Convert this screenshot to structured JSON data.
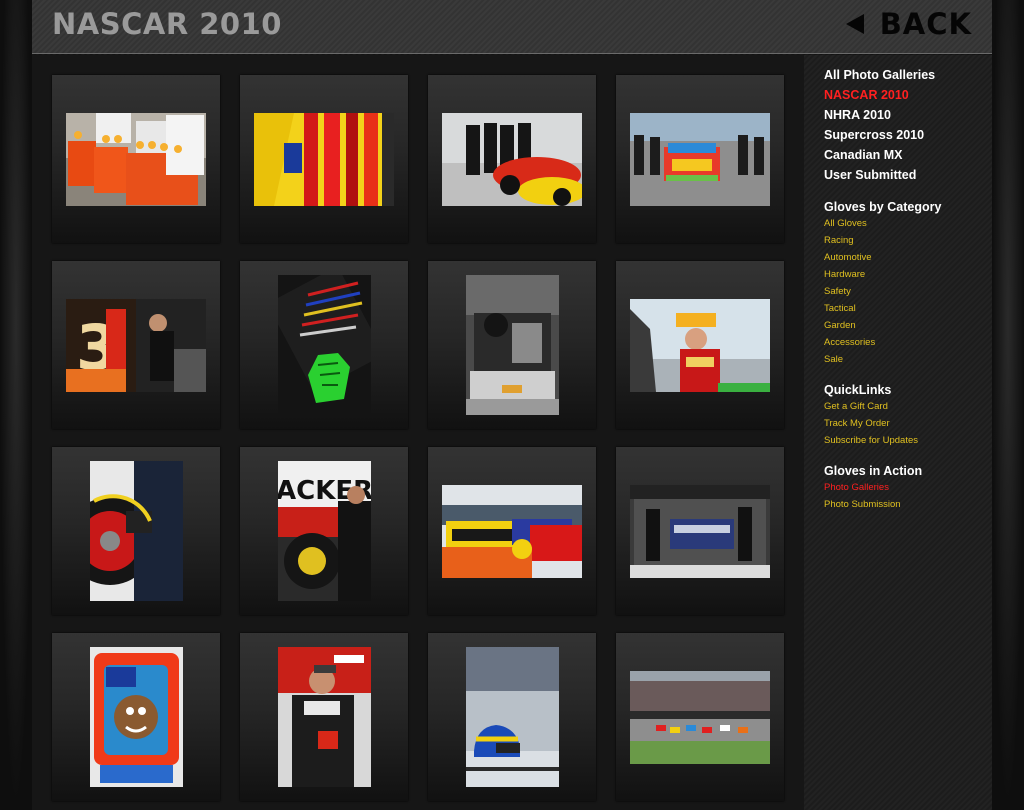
{
  "header": {
    "title": "NASCAR 2010",
    "back_label": "BACK"
  },
  "colors": {
    "title": "#9a9a9a",
    "nav_active": "#ff2020",
    "link_yellow": "#e0c020"
  },
  "sidebar": {
    "galleries": [
      {
        "label": "All Photo Galleries"
      },
      {
        "label": "NASCAR 2010",
        "active": true
      },
      {
        "label": "NHRA 2010"
      },
      {
        "label": "Supercross 2010"
      },
      {
        "label": "Canadian MX"
      },
      {
        "label": "User Submitted"
      }
    ],
    "categories": {
      "heading": "Gloves by Category",
      "items": [
        "All Gloves",
        "Racing",
        "Automotive",
        "Hardware",
        "Safety",
        "Tactical",
        "Garden",
        "Accessories",
        "Sale"
      ]
    },
    "quicklinks": {
      "heading": "QuickLinks",
      "items": [
        "Get a Gift Card",
        "Track My Order",
        "Subscribe for Updates"
      ]
    },
    "action": {
      "heading": "Gloves in Action",
      "items": [
        {
          "label": "Photo Galleries",
          "active": true
        },
        {
          "label": "Photo Submission"
        }
      ]
    }
  },
  "gallery": {
    "photos": [
      {
        "name": "coolers-photo",
        "orient": "land"
      },
      {
        "name": "car-sponsor-closeup-photo",
        "orient": "land"
      },
      {
        "name": "crew-at-cars-photo",
        "orient": "land"
      },
      {
        "name": "pit-lane-car-photo",
        "orient": "land"
      },
      {
        "name": "number-3-car-mechanic-photo",
        "orient": "land"
      },
      {
        "name": "tool-drawer-glove-photo",
        "orient": "port"
      },
      {
        "name": "engine-bay-photo",
        "orient": "port"
      },
      {
        "name": "cheesehead-fan-photo",
        "orient": "land"
      },
      {
        "name": "tire-change-photo",
        "orient": "port"
      },
      {
        "name": "crew-wheel-photo",
        "orient": "port"
      },
      {
        "name": "garage-cars-photo",
        "orient": "land"
      },
      {
        "name": "garage-bay-photo",
        "orient": "land"
      },
      {
        "name": "taz-sticker-photo",
        "orient": "port"
      },
      {
        "name": "driver-gloves-photo",
        "orient": "port"
      },
      {
        "name": "helmet-photo",
        "orient": "port"
      },
      {
        "name": "race-start-photo",
        "orient": "land"
      }
    ]
  }
}
